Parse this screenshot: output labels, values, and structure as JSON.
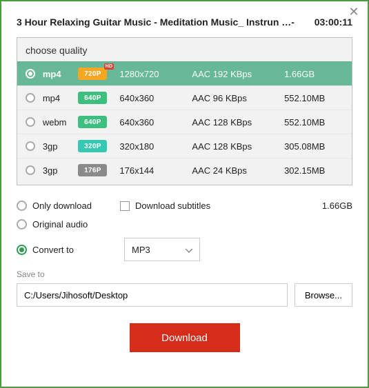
{
  "title": "3 Hour Relaxing Guitar Music - Meditation Music_ Instrun …-",
  "duration": "03:00:11",
  "quality": {
    "header": "choose quality",
    "rows": [
      {
        "format": "mp4",
        "badge": "720P",
        "badge_color": "#f5a623",
        "hd": "HD",
        "res": "1280x720",
        "codec": "AAC 192 KBps",
        "size": "1.66GB"
      },
      {
        "format": "mp4",
        "badge": "640P",
        "badge_color": "#3fbf7f",
        "hd": "",
        "res": "640x360",
        "codec": "AAC 96 KBps",
        "size": "552.10MB"
      },
      {
        "format": "webm",
        "badge": "640P",
        "badge_color": "#3fbf7f",
        "hd": "",
        "res": "640x360",
        "codec": "AAC 128 KBps",
        "size": "552.10MB"
      },
      {
        "format": "3gp",
        "badge": "320P",
        "badge_color": "#35c9b3",
        "hd": "",
        "res": "320x180",
        "codec": "AAC 128 KBps",
        "size": "305.08MB"
      },
      {
        "format": "3gp",
        "badge": "176P",
        "badge_color": "#8a8a8a",
        "hd": "",
        "res": "176x144",
        "codec": "AAC 24 KBps",
        "size": "302.15MB"
      }
    ]
  },
  "options": {
    "only_download": "Only download",
    "subtitles": "Download subtitles",
    "total_size": "1.66GB",
    "original_audio": "Original audio",
    "convert_to": "Convert to",
    "convert_value": "MP3"
  },
  "save": {
    "label": "Save to",
    "path": "C:/Users/Jihosoft/Desktop",
    "browse": "Browse..."
  },
  "download": "Download"
}
